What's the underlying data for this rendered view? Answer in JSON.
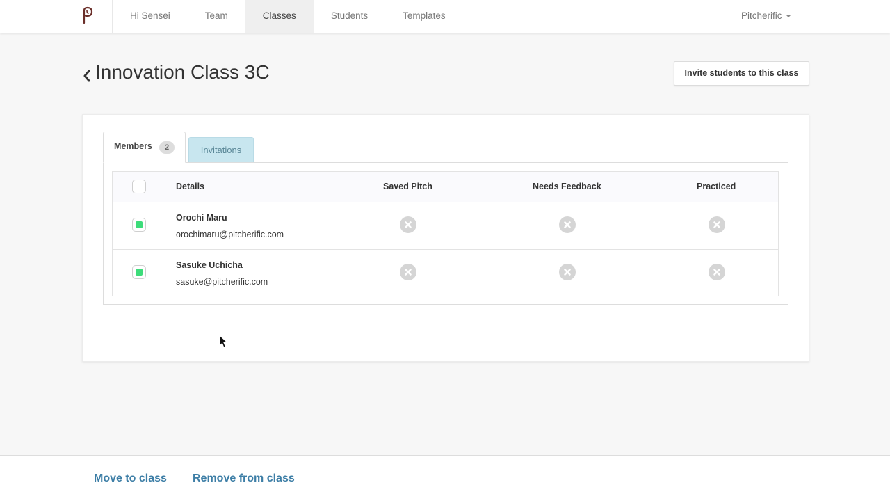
{
  "nav": {
    "items": [
      {
        "label": "Hi Sensei",
        "active": false
      },
      {
        "label": "Team",
        "active": false
      },
      {
        "label": "Classes",
        "active": true
      },
      {
        "label": "Students",
        "active": false
      },
      {
        "label": "Templates",
        "active": false
      }
    ],
    "account_label": "Pitcherific"
  },
  "header": {
    "title": "Innovation Class 3C",
    "invite_button": "Invite students to this class"
  },
  "tabs": {
    "members_label": "Members",
    "members_count": "2",
    "invitations_label": "Invitations"
  },
  "table": {
    "columns": {
      "details": "Details",
      "saved_pitch": "Saved Pitch",
      "needs_feedback": "Needs Feedback",
      "practiced": "Practiced"
    },
    "rows": [
      {
        "name": "Orochi Maru",
        "email": "orochimaru@pitcherific.com",
        "selected": true,
        "saved_pitch": "no",
        "needs_feedback": "no",
        "practiced": "no"
      },
      {
        "name": "Sasuke Uchicha",
        "email": "sasuke@pitcherific.com",
        "selected": true,
        "saved_pitch": "no",
        "needs_feedback": "no",
        "practiced": "no"
      }
    ]
  },
  "footer": {
    "move_label": "Move to class",
    "remove_label": "Remove from class"
  },
  "colors": {
    "link": "#3d7ea6",
    "checkbox_checked": "#3ddc7a",
    "invitations_tab_bg": "#c8e6ef",
    "status_icon": "#d5d5d5"
  }
}
